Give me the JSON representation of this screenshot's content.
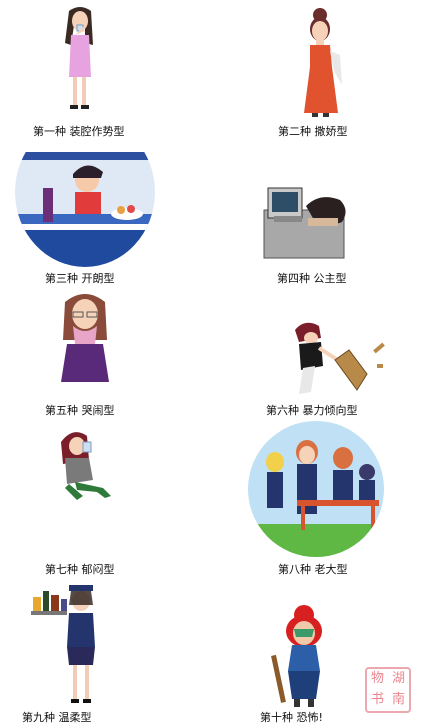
{
  "page": {
    "background": "#ffffff"
  },
  "items": [
    {
      "caption": "第一种  装腔作势型",
      "icon": "woman-drinking-icon"
    },
    {
      "caption": "第二种  撒娇型",
      "icon": "woman-red-dress-icon"
    },
    {
      "caption": "第三种  开朗型",
      "icon": "bar-scene-icon"
    },
    {
      "caption": "第四种  公主型",
      "icon": "woman-asleep-at-computer-icon"
    },
    {
      "caption": "第五种  哭闹型",
      "icon": "crying-woman-icon"
    },
    {
      "caption": "第六种  暴力倾向型",
      "icon": "woman-smashing-chair-icon"
    },
    {
      "caption": "第七种  郁闷型",
      "icon": "slumped-woman-drinking-icon"
    },
    {
      "caption": "第八种  老大型",
      "icon": "office-meeting-scene-icon"
    },
    {
      "caption": "第九种  温柔型",
      "icon": "waitress-with-tray-icon"
    },
    {
      "caption": "第十种  恐怖!",
      "icon": "scary-woman-with-club-icon"
    }
  ],
  "stamp": {
    "chars": [
      "湖",
      "物",
      "南",
      "书"
    ],
    "color": "#e8707d"
  }
}
